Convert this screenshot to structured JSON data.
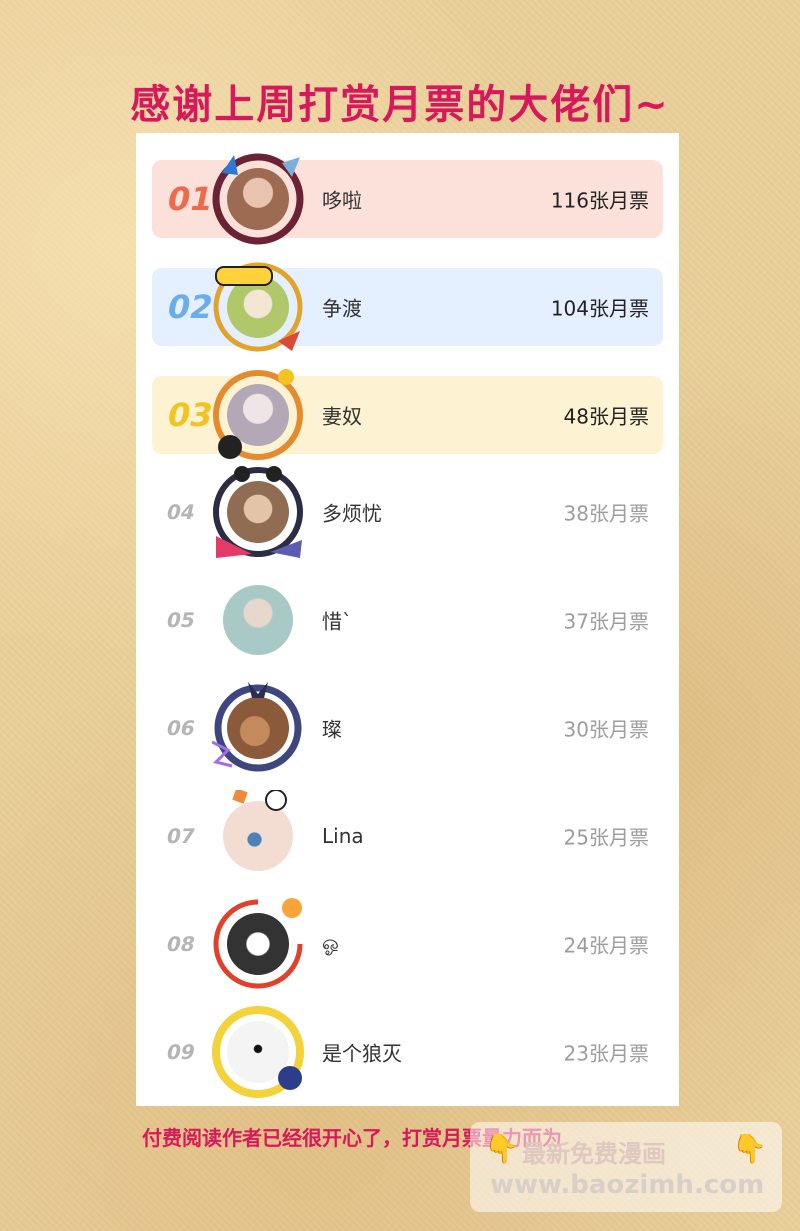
{
  "title": "感谢上周打赏月票的大佬们~",
  "rows": [
    {
      "rank": "01",
      "name": "哆啦",
      "votes": "116张月票",
      "bg": "#fbe1da",
      "rank_color": "#ef6a4a",
      "avatar_color": "#9c6b52",
      "frame_color": "#6a2234"
    },
    {
      "rank": "02",
      "name": "争渡",
      "votes": "104张月票",
      "bg": "#e4efff",
      "rank_color": "#6aaee9",
      "avatar_color": "#b1c86a",
      "frame_color": "#e2a32a"
    },
    {
      "rank": "03",
      "name": "妻奴",
      "votes": "48张月票",
      "bg": "#fdf3d3",
      "rank_color": "#f2c322",
      "avatar_color": "#b3a9b6",
      "frame_color": "#e58b2f"
    },
    {
      "rank": "04",
      "name": "多烦忧",
      "votes": "38张月票",
      "avatar_color": "#8f6c52",
      "frame_color": "#2c2c44"
    },
    {
      "rank": "05",
      "name": "惜`",
      "votes": "37张月票",
      "avatar_color": "#a8c9c6",
      "frame_color": ""
    },
    {
      "rank": "06",
      "name": "璨",
      "votes": "30张月票",
      "avatar_color": "#8a5a3a",
      "frame_color": "#3e4680"
    },
    {
      "rank": "07",
      "name": "Lina",
      "votes": "25张月票",
      "avatar_color": "#f3ddd2",
      "frame_color": ""
    },
    {
      "rank": "08",
      "name": "ஓ",
      "votes": "24张月票",
      "avatar_color": "#d9d9d9",
      "frame_color": "#e0402c"
    },
    {
      "rank": "09",
      "name": "是个狼灭",
      "votes": "23张月票",
      "avatar_color": "#f4f4f4",
      "frame_color": "#f3d23a"
    }
  ],
  "footer": "付费阅读作者已经很开心了，打赏月票量力而为",
  "watermark": {
    "line1": "最新免费漫画",
    "line2": "www.baozimh.com"
  },
  "icons": {
    "hand": "pointing-down-hand-icon"
  }
}
